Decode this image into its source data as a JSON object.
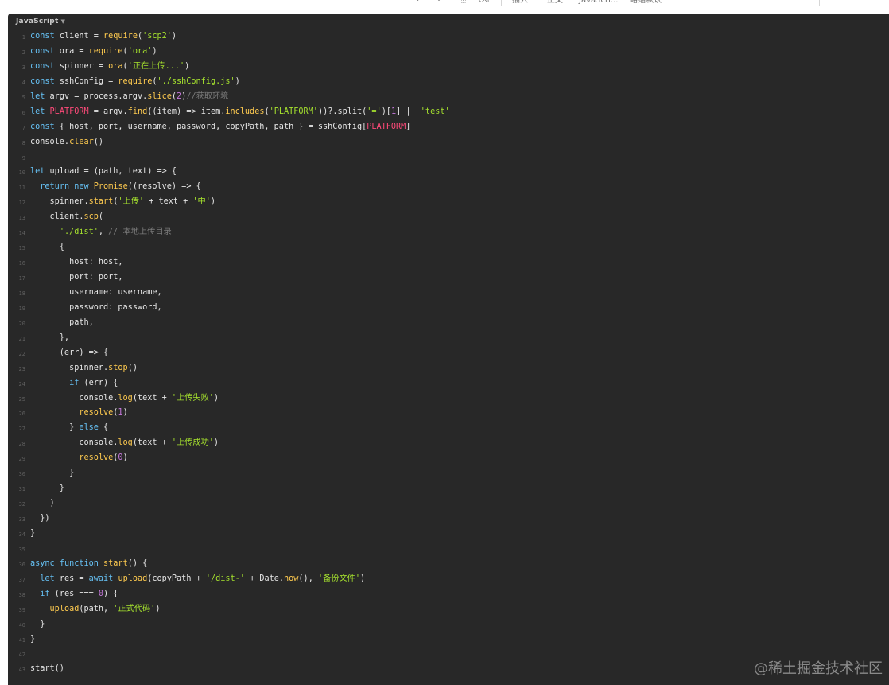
{
  "toolbar": {
    "items": [
      {
        "name": "undo-icon",
        "glyph": "↶"
      },
      {
        "name": "redo-icon",
        "glyph": "↷"
      },
      {
        "name": "format-painter-icon",
        "glyph": "⎘"
      },
      {
        "name": "clear-format-icon",
        "glyph": "⌫"
      },
      {
        "name": "insert-menu",
        "label": "插入"
      },
      {
        "name": "text-style-menu",
        "label": "正文"
      },
      {
        "name": "font-menu",
        "label": "JavaScri..."
      },
      {
        "name": "font-size-menu",
        "label": "略缩默认"
      }
    ]
  },
  "editor": {
    "language_label": "JavaScript",
    "lines": [
      [
        [
          "k",
          "const"
        ],
        [
          "p",
          " client = "
        ],
        [
          "f",
          "require"
        ],
        [
          "p",
          "("
        ],
        [
          "s",
          "'scp2'"
        ],
        [
          "p",
          ")"
        ]
      ],
      [
        [
          "k",
          "const"
        ],
        [
          "p",
          " ora = "
        ],
        [
          "f",
          "require"
        ],
        [
          "p",
          "("
        ],
        [
          "s",
          "'ora'"
        ],
        [
          "p",
          ")"
        ]
      ],
      [
        [
          "k",
          "const"
        ],
        [
          "p",
          " spinner = "
        ],
        [
          "f",
          "ora"
        ],
        [
          "p",
          "("
        ],
        [
          "s",
          "'正在上传...'"
        ],
        [
          "p",
          ")"
        ]
      ],
      [
        [
          "k",
          "const"
        ],
        [
          "p",
          " sshConfig = "
        ],
        [
          "f",
          "require"
        ],
        [
          "p",
          "("
        ],
        [
          "s",
          "'./sshConfig.js'"
        ],
        [
          "p",
          ")"
        ]
      ],
      [
        [
          "k",
          "let"
        ],
        [
          "p",
          " argv = process.argv."
        ],
        [
          "f",
          "slice"
        ],
        [
          "p",
          "("
        ],
        [
          "n",
          "2"
        ],
        [
          "p",
          ")"
        ],
        [
          "c",
          "//获取环境"
        ]
      ],
      [
        [
          "k",
          "let"
        ],
        [
          "p",
          " "
        ],
        [
          "v",
          "PLATFORM"
        ],
        [
          "p",
          " = argv."
        ],
        [
          "f",
          "find"
        ],
        [
          "p",
          "((item) => item."
        ],
        [
          "f",
          "includes"
        ],
        [
          "p",
          "("
        ],
        [
          "s",
          "'PLATFORM'"
        ],
        [
          "p",
          "))?.split("
        ],
        [
          "s",
          "'='"
        ],
        [
          "p",
          ")["
        ],
        [
          "n",
          "1"
        ],
        [
          "p",
          "] || "
        ],
        [
          "s",
          "'test'"
        ]
      ],
      [
        [
          "k",
          "const"
        ],
        [
          "p",
          " { host, port, username, password, copyPath, path } = sshConfig["
        ],
        [
          "v",
          "PLATFORM"
        ],
        [
          "p",
          "]"
        ]
      ],
      [
        [
          "p",
          "console."
        ],
        [
          "f",
          "clear"
        ],
        [
          "p",
          "()"
        ]
      ],
      [],
      [
        [
          "k",
          "let"
        ],
        [
          "p",
          " upload = (path, text) => {"
        ]
      ],
      [
        [
          "p",
          "  "
        ],
        [
          "k",
          "return"
        ],
        [
          "p",
          " "
        ],
        [
          "k",
          "new"
        ],
        [
          "p",
          " "
        ],
        [
          "f",
          "Promise"
        ],
        [
          "p",
          "((resolve) => {"
        ]
      ],
      [
        [
          "p",
          "    spinner."
        ],
        [
          "f",
          "start"
        ],
        [
          "p",
          "("
        ],
        [
          "s",
          "'上传'"
        ],
        [
          "p",
          " + text + "
        ],
        [
          "s",
          "'中'"
        ],
        [
          "p",
          ")"
        ]
      ],
      [
        [
          "p",
          "    client."
        ],
        [
          "f",
          "scp"
        ],
        [
          "p",
          "("
        ]
      ],
      [
        [
          "p",
          "      "
        ],
        [
          "s",
          "'./dist'"
        ],
        [
          "p",
          ", "
        ],
        [
          "c",
          "// 本地上传目录"
        ]
      ],
      [
        [
          "p",
          "      {"
        ]
      ],
      [
        [
          "p",
          "        host: host,"
        ]
      ],
      [
        [
          "p",
          "        port: port,"
        ]
      ],
      [
        [
          "p",
          "        username: username,"
        ]
      ],
      [
        [
          "p",
          "        password: password,"
        ]
      ],
      [
        [
          "p",
          "        path,"
        ]
      ],
      [
        [
          "p",
          "      },"
        ]
      ],
      [
        [
          "p",
          "      (err) => {"
        ]
      ],
      [
        [
          "p",
          "        spinner."
        ],
        [
          "f",
          "stop"
        ],
        [
          "p",
          "()"
        ]
      ],
      [
        [
          "p",
          "        "
        ],
        [
          "k",
          "if"
        ],
        [
          "p",
          " (err) {"
        ]
      ],
      [
        [
          "p",
          "          console."
        ],
        [
          "f",
          "log"
        ],
        [
          "p",
          "(text + "
        ],
        [
          "s",
          "'上传失败'"
        ],
        [
          "p",
          ")"
        ]
      ],
      [
        [
          "p",
          "          "
        ],
        [
          "f",
          "resolve"
        ],
        [
          "p",
          "("
        ],
        [
          "n",
          "1"
        ],
        [
          "p",
          ")"
        ]
      ],
      [
        [
          "p",
          "        } "
        ],
        [
          "k",
          "else"
        ],
        [
          "p",
          " {"
        ]
      ],
      [
        [
          "p",
          "          console."
        ],
        [
          "f",
          "log"
        ],
        [
          "p",
          "(text + "
        ],
        [
          "s",
          "'上传成功'"
        ],
        [
          "p",
          ")"
        ]
      ],
      [
        [
          "p",
          "          "
        ],
        [
          "f",
          "resolve"
        ],
        [
          "p",
          "("
        ],
        [
          "n",
          "0"
        ],
        [
          "p",
          ")"
        ]
      ],
      [
        [
          "p",
          "        }"
        ]
      ],
      [
        [
          "p",
          "      }"
        ]
      ],
      [
        [
          "p",
          "    )"
        ]
      ],
      [
        [
          "p",
          "  })"
        ]
      ],
      [
        [
          "p",
          "}"
        ]
      ],
      [],
      [
        [
          "k",
          "async"
        ],
        [
          "p",
          " "
        ],
        [
          "k",
          "function"
        ],
        [
          "p",
          " "
        ],
        [
          "f",
          "start"
        ],
        [
          "p",
          "() {"
        ]
      ],
      [
        [
          "p",
          "  "
        ],
        [
          "k",
          "let"
        ],
        [
          "p",
          " res = "
        ],
        [
          "k",
          "await"
        ],
        [
          "p",
          " "
        ],
        [
          "f",
          "upload"
        ],
        [
          "p",
          "(copyPath + "
        ],
        [
          "s",
          "'/dist-'"
        ],
        [
          "p",
          " + Date."
        ],
        [
          "f",
          "now"
        ],
        [
          "p",
          "(), "
        ],
        [
          "s",
          "'备份文件'"
        ],
        [
          "p",
          ")"
        ]
      ],
      [
        [
          "p",
          "  "
        ],
        [
          "k",
          "if"
        ],
        [
          "p",
          " (res === "
        ],
        [
          "n",
          "0"
        ],
        [
          "p",
          ") {"
        ]
      ],
      [
        [
          "p",
          "    "
        ],
        [
          "f",
          "upload"
        ],
        [
          "p",
          "(path, "
        ],
        [
          "s",
          "'正式代码'"
        ],
        [
          "p",
          ")"
        ]
      ],
      [
        [
          "p",
          "  }"
        ]
      ],
      [
        [
          "p",
          "}"
        ]
      ],
      [],
      [
        [
          "p",
          "start()"
        ]
      ]
    ]
  },
  "watermark": "@稀土掘金技术社区"
}
